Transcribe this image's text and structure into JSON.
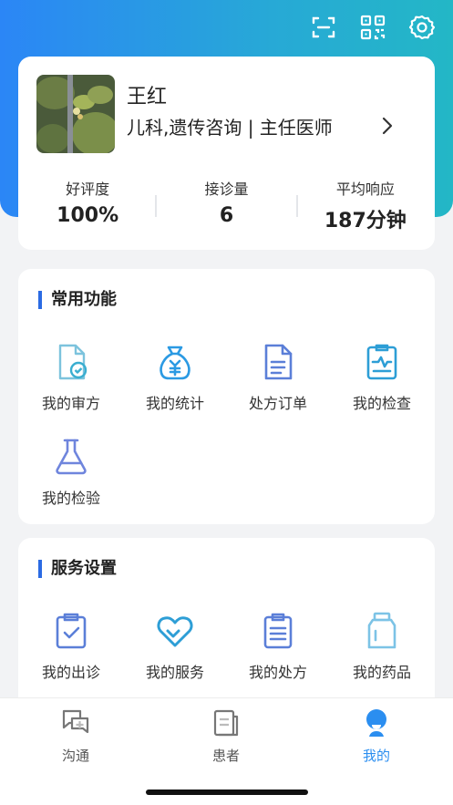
{
  "doctor": {
    "name": "王红",
    "department": "儿科,遗传咨询 |  主任医师"
  },
  "stats": [
    {
      "label": "好评度",
      "value": "100%"
    },
    {
      "label": "接诊量",
      "value": "6"
    },
    {
      "label": "平均响应",
      "value": "187分钟"
    }
  ],
  "common": {
    "title": "常用功能",
    "items": [
      {
        "label": "我的审方",
        "icon": "audit-doc-icon"
      },
      {
        "label": "我的统计",
        "icon": "money-bag-icon"
      },
      {
        "label": "处方订单",
        "icon": "document-icon"
      },
      {
        "label": "我的检查",
        "icon": "clipboard-chart-icon"
      },
      {
        "label": "我的检验",
        "icon": "flask-icon"
      }
    ]
  },
  "service": {
    "title": "服务设置",
    "items": [
      {
        "label": "我的出诊",
        "icon": "clipboard-check-icon"
      },
      {
        "label": "我的服务",
        "icon": "heart-icon"
      },
      {
        "label": "我的处方",
        "icon": "clipboard-list-icon"
      },
      {
        "label": "我的药品",
        "icon": "medicine-bottle-icon"
      }
    ]
  },
  "tabs": [
    {
      "label": "沟通",
      "icon": "chat-plus-icon"
    },
    {
      "label": "患者",
      "icon": "patient-record-icon"
    },
    {
      "label": "我的",
      "icon": "profile-icon",
      "active": true
    }
  ],
  "colors": {
    "accent": "#2b8ef0",
    "header_start": "#2b86f6",
    "header_end": "#23b7c6",
    "section_bar": "#2b6be3"
  }
}
